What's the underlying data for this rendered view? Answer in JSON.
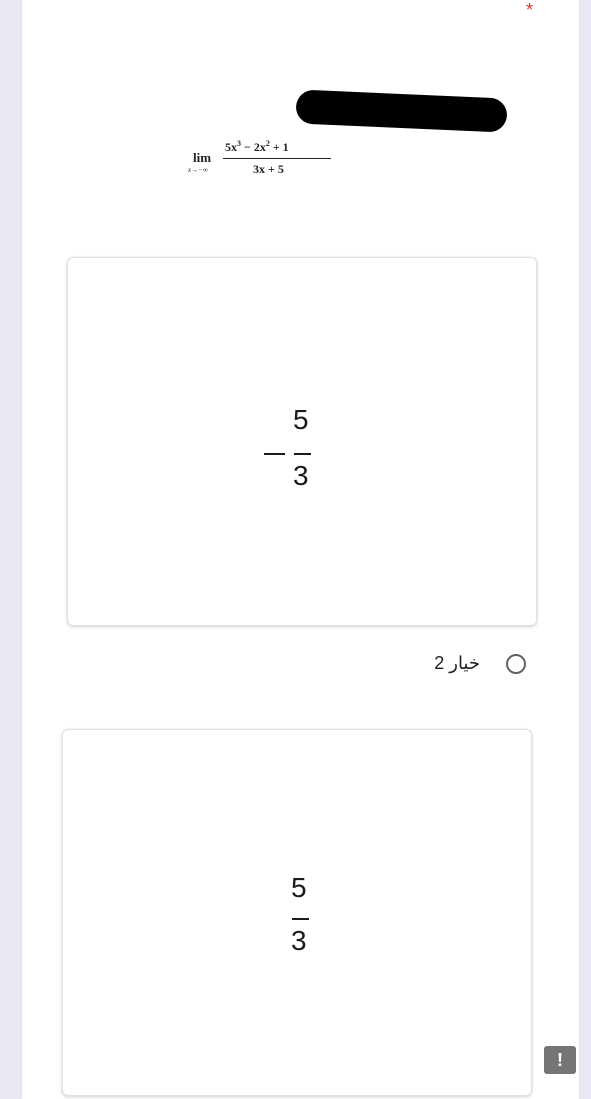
{
  "question": {
    "required_marker": "*",
    "formula": {
      "lim_word": "lim",
      "lim_subscript": "x→−∞",
      "numerator_parts": [
        "5x",
        "3",
        " − 2x",
        "2",
        " + 1"
      ],
      "denominator": "3x + 5"
    }
  },
  "options": [
    {
      "label": "",
      "image_fraction": {
        "sign": "−",
        "numerator": "5",
        "denominator": "3"
      }
    },
    {
      "label": "خيار 2",
      "image_fraction": {
        "sign": "",
        "numerator": "5",
        "denominator": "3"
      }
    }
  ],
  "feedback_button": {
    "icon": "feedback-icon",
    "glyph": "!"
  },
  "colors": {
    "page_background": "#ece8f3",
    "required": "#d93025",
    "radio": "#5f6368"
  }
}
